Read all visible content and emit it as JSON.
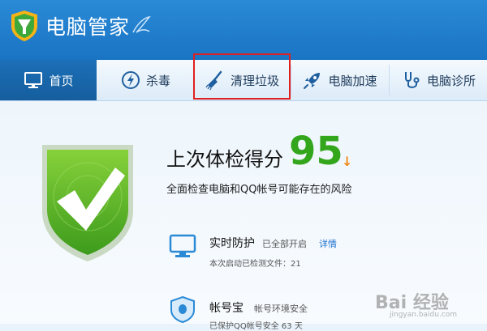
{
  "app": {
    "title": "电脑管家"
  },
  "nav": {
    "items": [
      {
        "label": "首页",
        "icon": "monitor-icon",
        "active": true
      },
      {
        "label": "杀毒",
        "icon": "lightning-icon"
      },
      {
        "label": "清理垃圾",
        "icon": "broom-icon",
        "highlighted": true
      },
      {
        "label": "电脑加速",
        "icon": "rocket-icon"
      },
      {
        "label": "电脑诊所",
        "icon": "stethoscope-icon"
      }
    ],
    "highlight_color": "#e0201f"
  },
  "score": {
    "title": "上次体检得分",
    "value": "95",
    "trend_icon": "down-arrow-icon",
    "description": "全面检查电脑和QQ帐号可能存在的风险"
  },
  "features": [
    {
      "title": "实时防护",
      "status": "已全部开启",
      "link": "详情",
      "sub": "本次启动已检测文件：21",
      "icon": "monitor-shield-icon"
    },
    {
      "title": "帐号宝",
      "status": "帐号环境安全",
      "sub": "已保护QQ帐号安全 63 天",
      "icon": "qq-shield-icon"
    }
  ],
  "watermark": {
    "text": "Bai 经验",
    "sub": "jingyan.baidu.com"
  },
  "colors": {
    "titlebar": "#1f7fcf",
    "score": "#33a61c",
    "accent_orange": "#f08a17",
    "link": "#1c6fd0"
  }
}
